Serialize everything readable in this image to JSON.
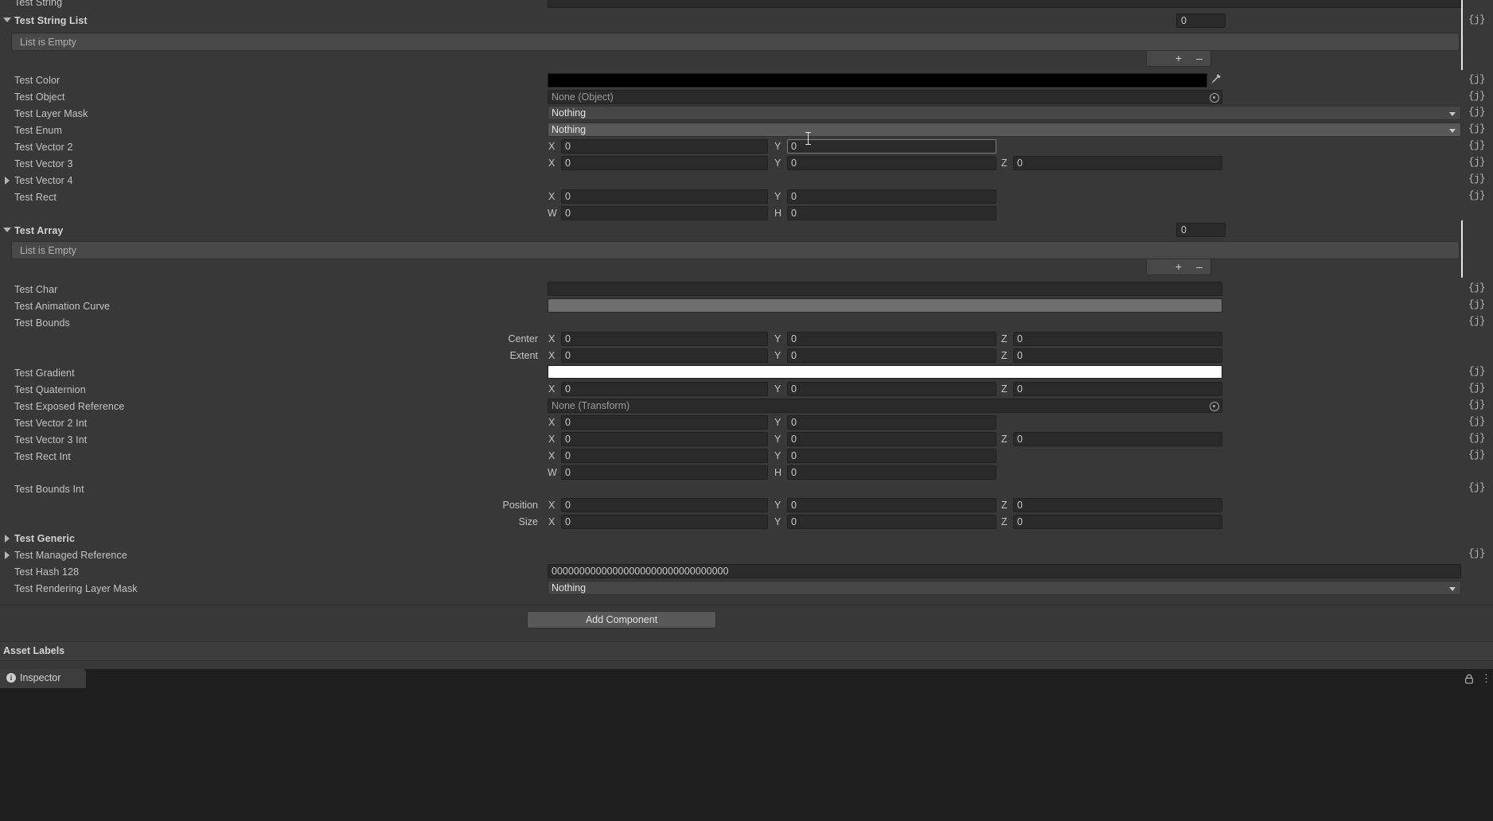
{
  "app": {
    "title": "Inspector",
    "panel_bg": "#383838",
    "field_bg": "#2a2a2a",
    "popup_bg": "#585858"
  },
  "gutter": {
    "bind_icon": "{j}",
    "bind_icon_name": "property-binding-icon"
  },
  "properties": {
    "test_string": {
      "label": "Test String",
      "value": ""
    },
    "test_string_list": {
      "label": "Test String List",
      "empty_text": "List is Empty",
      "size": "0",
      "add_label": "+",
      "remove_label": "–"
    },
    "test_color": {
      "label": "Test Color",
      "value": "#000000",
      "eyedropper": "✐"
    },
    "test_object": {
      "label": "Test Object",
      "value": "None (Object)"
    },
    "test_layer_mask": {
      "label": "Test Layer Mask",
      "value": "Nothing"
    },
    "test_enum": {
      "label": "Test Enum",
      "value": "Nothing"
    },
    "test_vector2": {
      "label": "Test Vector 2",
      "x_axis": "X",
      "x": "0",
      "y_axis": "Y",
      "y": "0"
    },
    "test_vector3": {
      "label": "Test Vector 3",
      "x_axis": "X",
      "x": "0",
      "y_axis": "Y",
      "y": "0",
      "z_axis": "Z",
      "z": "0"
    },
    "test_vector4": {
      "label": "Test Vector 4"
    },
    "test_rect": {
      "label": "Test Rect",
      "x_axis": "X",
      "x": "0",
      "y_axis": "Y",
      "y": "0",
      "w_axis": "W",
      "w": "0",
      "h_axis": "H",
      "h": "0"
    },
    "test_array": {
      "label": "Test Array",
      "empty_text": "List is Empty",
      "size": "0",
      "add_label": "+",
      "remove_label": "–"
    },
    "test_char": {
      "label": "Test Char",
      "value": ""
    },
    "test_animation_curve": {
      "label": "Test Animation Curve"
    },
    "test_bounds": {
      "label": "Test Bounds",
      "center_label": "Center",
      "center": {
        "x_axis": "X",
        "x": "0",
        "y_axis": "Y",
        "y": "0",
        "z_axis": "Z",
        "z": "0"
      },
      "extent_label": "Extent",
      "extent": {
        "x_axis": "X",
        "x": "0",
        "y_axis": "Y",
        "y": "0",
        "z_axis": "Z",
        "z": "0"
      }
    },
    "test_gradient": {
      "label": "Test Gradient",
      "value": "#ffffff"
    },
    "test_quaternion": {
      "label": "Test Quaternion",
      "x_axis": "X",
      "x": "0",
      "y_axis": "Y",
      "y": "0",
      "z_axis": "Z",
      "z": "0"
    },
    "test_exposed_reference": {
      "label": "Test Exposed Reference",
      "value": "None (Transform)"
    },
    "test_vector2_int": {
      "label": "Test Vector 2 Int",
      "x_axis": "X",
      "x": "0",
      "y_axis": "Y",
      "y": "0"
    },
    "test_vector3_int": {
      "label": "Test Vector 3 Int",
      "x_axis": "X",
      "x": "0",
      "y_axis": "Y",
      "y": "0",
      "z_axis": "Z",
      "z": "0"
    },
    "test_rect_int": {
      "label": "Test Rect Int",
      "x_axis": "X",
      "x": "0",
      "y_axis": "Y",
      "y": "0",
      "w_axis": "W",
      "w": "0",
      "h_axis": "H",
      "h": "0"
    },
    "test_bounds_int": {
      "label": "Test Bounds Int",
      "position_label": "Position",
      "position": {
        "x_axis": "X",
        "x": "0",
        "y_axis": "Y",
        "y": "0",
        "z_axis": "Z",
        "z": "0"
      },
      "size_label": "Size",
      "size": {
        "x_axis": "X",
        "x": "0",
        "y_axis": "Y",
        "y": "0",
        "z_axis": "Z",
        "z": "0"
      }
    },
    "test_generic": {
      "label": "Test Generic"
    },
    "test_managed_reference": {
      "label": "Test Managed Reference"
    },
    "test_hash_128": {
      "label": "Test Hash 128",
      "value": "00000000000000000000000000000000"
    },
    "test_rendering_layer_mask": {
      "label": "Test Rendering Layer Mask",
      "value": "Nothing"
    }
  },
  "footer": {
    "add_component_label": "Add Component",
    "asset_labels_label": "Asset Labels"
  },
  "tabbar": {
    "inspector_tab_label": "Inspector",
    "info_icon_glyph": "i",
    "lock_icon_glyph": "⚿",
    "menu_icon_glyph": "⋮"
  }
}
